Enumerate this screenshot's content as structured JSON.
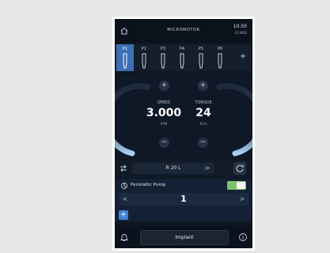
{
  "app": {
    "title": "MICROMOTOR",
    "time": "10:50",
    "date": "03.MED"
  },
  "tabs": [
    {
      "label": "P1",
      "active": true
    },
    {
      "label": "P2",
      "active": false
    },
    {
      "label": "P3",
      "active": false
    },
    {
      "label": "P4",
      "active": false
    },
    {
      "label": "P5",
      "active": false
    },
    {
      "label": "P6",
      "active": false
    }
  ],
  "tabs_add": "+",
  "speed": {
    "label": "SPEED",
    "value": "3.000",
    "unit": "RPM",
    "plus": "+",
    "minus": "−"
  },
  "torque": {
    "label": "TORQUE",
    "value": "24",
    "unit": "Ncm",
    "plus": "+",
    "minus": "−"
  },
  "program": {
    "value": "R 20 L",
    "arrow": ">"
  },
  "pump": {
    "label": "Peristaltic Pump",
    "enabled": true,
    "value": "1",
    "decrement": "<",
    "increment": ">",
    "add": "+"
  },
  "bottom": {
    "mode": "Implant"
  },
  "colors": {
    "accent": "#3d6fb5",
    "gauge": "#9fc7ee",
    "toggle_on": "#7ec36b",
    "background": "#0e1622"
  }
}
